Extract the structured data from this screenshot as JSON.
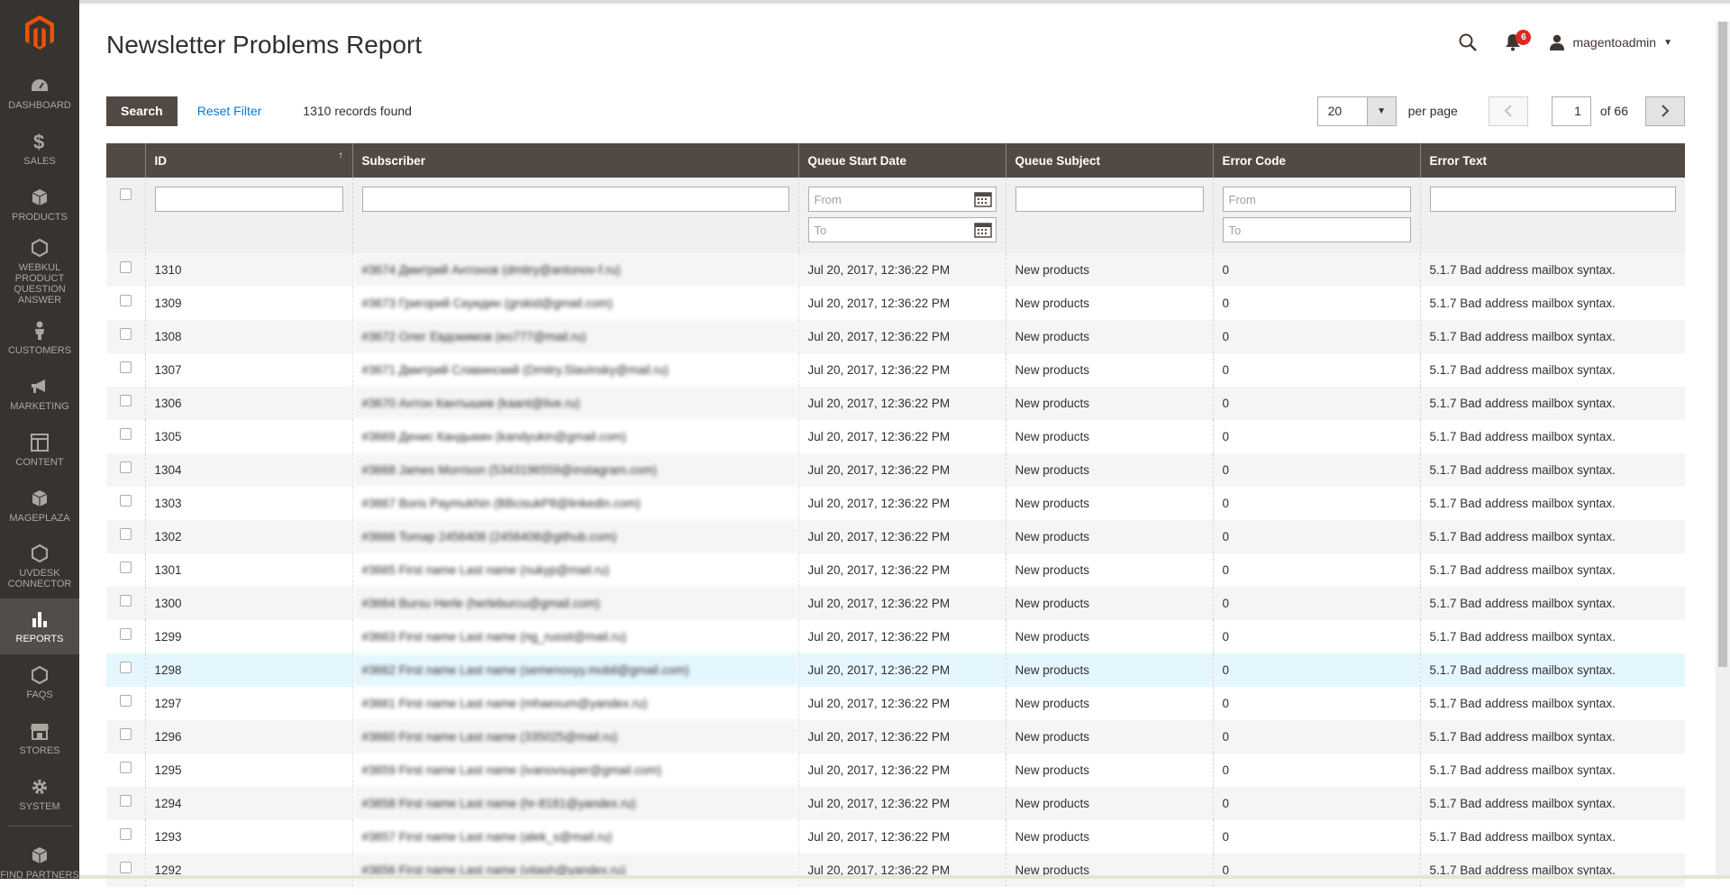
{
  "sidebar": {
    "logo": "magento-logo",
    "items": [
      {
        "label": "DASHBOARD",
        "icon": "dashboard-icon"
      },
      {
        "label": "SALES",
        "icon": "dollar-icon"
      },
      {
        "label": "PRODUCTS",
        "icon": "cube-icon"
      },
      {
        "label": "WEBKUL PRODUCT QUESTION ANSWER",
        "icon": "hexagon-icon"
      },
      {
        "label": "CUSTOMERS",
        "icon": "person-icon"
      },
      {
        "label": "MARKETING",
        "icon": "megaphone-icon"
      },
      {
        "label": "CONTENT",
        "icon": "layout-icon"
      },
      {
        "label": "MAGEPLAZA",
        "icon": "cube-icon"
      },
      {
        "label": "UVDESK CONNECTOR",
        "icon": "hexagon-icon"
      },
      {
        "label": "REPORTS",
        "icon": "bar-chart-icon"
      },
      {
        "label": "FAQS",
        "icon": "hexagon-icon"
      },
      {
        "label": "STORES",
        "icon": "storefront-icon"
      },
      {
        "label": "SYSTEM",
        "icon": "gear-icon"
      },
      {
        "label": "FIND PARTNERS",
        "icon": "cube-icon"
      }
    ]
  },
  "header": {
    "title": "Newsletter Problems Report",
    "notifications_count": "6",
    "username": "magentoadmin"
  },
  "toolbar": {
    "search_label": "Search",
    "reset_label": "Reset Filter",
    "records_found": "1310 records found",
    "per_page_value": "20",
    "per_page_label": "per page",
    "current_page": "1",
    "of_pages": "of 66"
  },
  "grid": {
    "columns": [
      "ID",
      "Subscriber",
      "Queue Start Date",
      "Queue Subject",
      "Error Code",
      "Error Text"
    ],
    "filters": {
      "from_placeholder": "From",
      "to_placeholder": "To"
    },
    "rows": [
      {
        "id": "1310",
        "subscriber": "#3674 Дмитрий Антонов (dmitry@antonov-f.ru)",
        "date": "Jul 20, 2017, 12:36:22 PM",
        "subject": "New products",
        "code": "0",
        "error": "5.1.7 Bad address mailbox syntax."
      },
      {
        "id": "1309",
        "subscriber": "#3673 Григорий Скуидин (grskid@gmail.com)",
        "date": "Jul 20, 2017, 12:36:22 PM",
        "subject": "New products",
        "code": "0",
        "error": "5.1.7 Bad address mailbox syntax."
      },
      {
        "id": "1308",
        "subscriber": "#3672 Олег Евдокимов (eo777@mail.ru)",
        "date": "Jul 20, 2017, 12:36:22 PM",
        "subject": "New products",
        "code": "0",
        "error": "5.1.7 Bad address mailbox syntax."
      },
      {
        "id": "1307",
        "subscriber": "#3671 Дмитрий Славинский (Dmitry.Slavinsky@mail.ru)",
        "date": "Jul 20, 2017, 12:36:22 PM",
        "subject": "New products",
        "code": "0",
        "error": "5.1.7 Bad address mailbox syntax."
      },
      {
        "id": "1306",
        "subscriber": "#3670 Антон Кантышев (kaant@live.ru)",
        "date": "Jul 20, 2017, 12:36:22 PM",
        "subject": "New products",
        "code": "0",
        "error": "5.1.7 Bad address mailbox syntax."
      },
      {
        "id": "1305",
        "subscriber": "#3669 Денис Кандыкин (kandyukin@gmail.com)",
        "date": "Jul 20, 2017, 12:36:22 PM",
        "subject": "New products",
        "code": "0",
        "error": "5.1.7 Bad address mailbox syntax."
      },
      {
        "id": "1304",
        "subscriber": "#3668 James Morrison (5343196559@instagram.com)",
        "date": "Jul 20, 2017, 12:36:22 PM",
        "subject": "New products",
        "code": "0",
        "error": "5.1.7 Bad address mailbox syntax."
      },
      {
        "id": "1303",
        "subscriber": "#3667 Boris Paymukhin (BBcisukP8@linkedin.com)",
        "date": "Jul 20, 2017, 12:36:22 PM",
        "subject": "New products",
        "code": "0",
        "error": "5.1.7 Bad address mailbox syntax."
      },
      {
        "id": "1302",
        "subscriber": "#3666 Tomap 2456408 (2456408@github.com)",
        "date": "Jul 20, 2017, 12:36:22 PM",
        "subject": "New products",
        "code": "0",
        "error": "5.1.7 Bad address mailbox syntax."
      },
      {
        "id": "1301",
        "subscriber": "#3665 First name Last name (nukyp@mail.ru)",
        "date": "Jul 20, 2017, 12:36:22 PM",
        "subject": "New products",
        "code": "0",
        "error": "5.1.7 Bad address mailbox syntax."
      },
      {
        "id": "1300",
        "subscriber": "#3664 Bursu Herle (herleburcu@gmail.com)",
        "date": "Jul 20, 2017, 12:36:22 PM",
        "subject": "New products",
        "code": "0",
        "error": "5.1.7 Bad address mailbox syntax."
      },
      {
        "id": "1299",
        "subscriber": "#3663 First name Last name (ng_russit@mail.ru)",
        "date": "Jul 20, 2017, 12:36:22 PM",
        "subject": "New products",
        "code": "0",
        "error": "5.1.7 Bad address mailbox syntax."
      },
      {
        "id": "1298",
        "subscriber": "#3662 First name Last name (semenovyy.mobil@gmail.com)",
        "date": "Jul 20, 2017, 12:36:22 PM",
        "subject": "New products",
        "code": "0",
        "error": "5.1.7 Bad address mailbox syntax."
      },
      {
        "id": "1297",
        "subscriber": "#3661 First name Last name (mhaexum@yandex.ru)",
        "date": "Jul 20, 2017, 12:36:22 PM",
        "subject": "New products",
        "code": "0",
        "error": "5.1.7 Bad address mailbox syntax."
      },
      {
        "id": "1296",
        "subscriber": "#3660 First name Last name (335025@mail.ru)",
        "date": "Jul 20, 2017, 12:36:22 PM",
        "subject": "New products",
        "code": "0",
        "error": "5.1.7 Bad address mailbox syntax."
      },
      {
        "id": "1295",
        "subscriber": "#3659 First name Last name (ivanovsuper@gmail.com)",
        "date": "Jul 20, 2017, 12:36:22 PM",
        "subject": "New products",
        "code": "0",
        "error": "5.1.7 Bad address mailbox syntax."
      },
      {
        "id": "1294",
        "subscriber": "#3658 First name Last name (hr-8181@yandex.ru)",
        "date": "Jul 20, 2017, 12:36:22 PM",
        "subject": "New products",
        "code": "0",
        "error": "5.1.7 Bad address mailbox syntax."
      },
      {
        "id": "1293",
        "subscriber": "#3657 First name Last name (alek_s@mail.ru)",
        "date": "Jul 20, 2017, 12:36:22 PM",
        "subject": "New products",
        "code": "0",
        "error": "5.1.7 Bad address mailbox syntax."
      },
      {
        "id": "1292",
        "subscriber": "#3656 First name Last name (vitash@yandex.ru)",
        "date": "Jul 20, 2017, 12:36:22 PM",
        "subject": "New products",
        "code": "0",
        "error": "5.1.7 Bad address mailbox syntax."
      }
    ]
  },
  "colors": {
    "sidebar_bg": "#373330",
    "header_bg": "#514943",
    "accent": "#eb5202",
    "link": "#007bdb",
    "badge": "#e22626",
    "row_highlight": "#e5f7fe"
  }
}
